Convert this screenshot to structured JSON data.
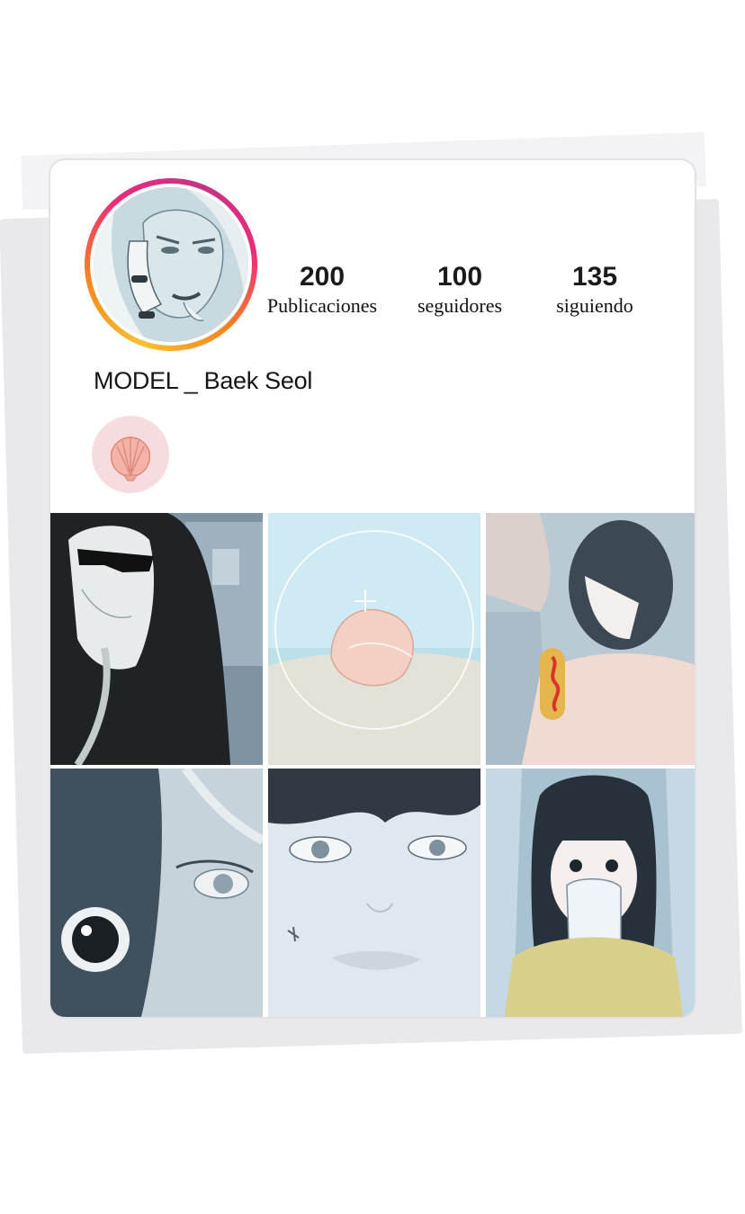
{
  "profile": {
    "username": "MODEL _ Baek Seol",
    "avatar_icon": "profile-avatar-illustration",
    "ring_colors": [
      "#f8c12f",
      "#f5841f",
      "#ee2a7b",
      "#c13584"
    ]
  },
  "stats": [
    {
      "count": "200",
      "label": "Publicaciones"
    },
    {
      "count": "100",
      "label": "seguidores"
    },
    {
      "count": "135",
      "label": "siguiendo"
    }
  ],
  "highlights": [
    {
      "icon": "seashell-icon",
      "color": "#f7dcdf"
    }
  ],
  "posts": [
    {
      "icon": "hooded-man-sunglasses-image"
    },
    {
      "icon": "seashell-on-sand-image"
    },
    {
      "icon": "girl-with-corndog-image"
    },
    {
      "icon": "closeup-eyes-image"
    },
    {
      "icon": "boy-face-closeup-image"
    },
    {
      "icon": "girl-covering-mouth-image"
    }
  ]
}
